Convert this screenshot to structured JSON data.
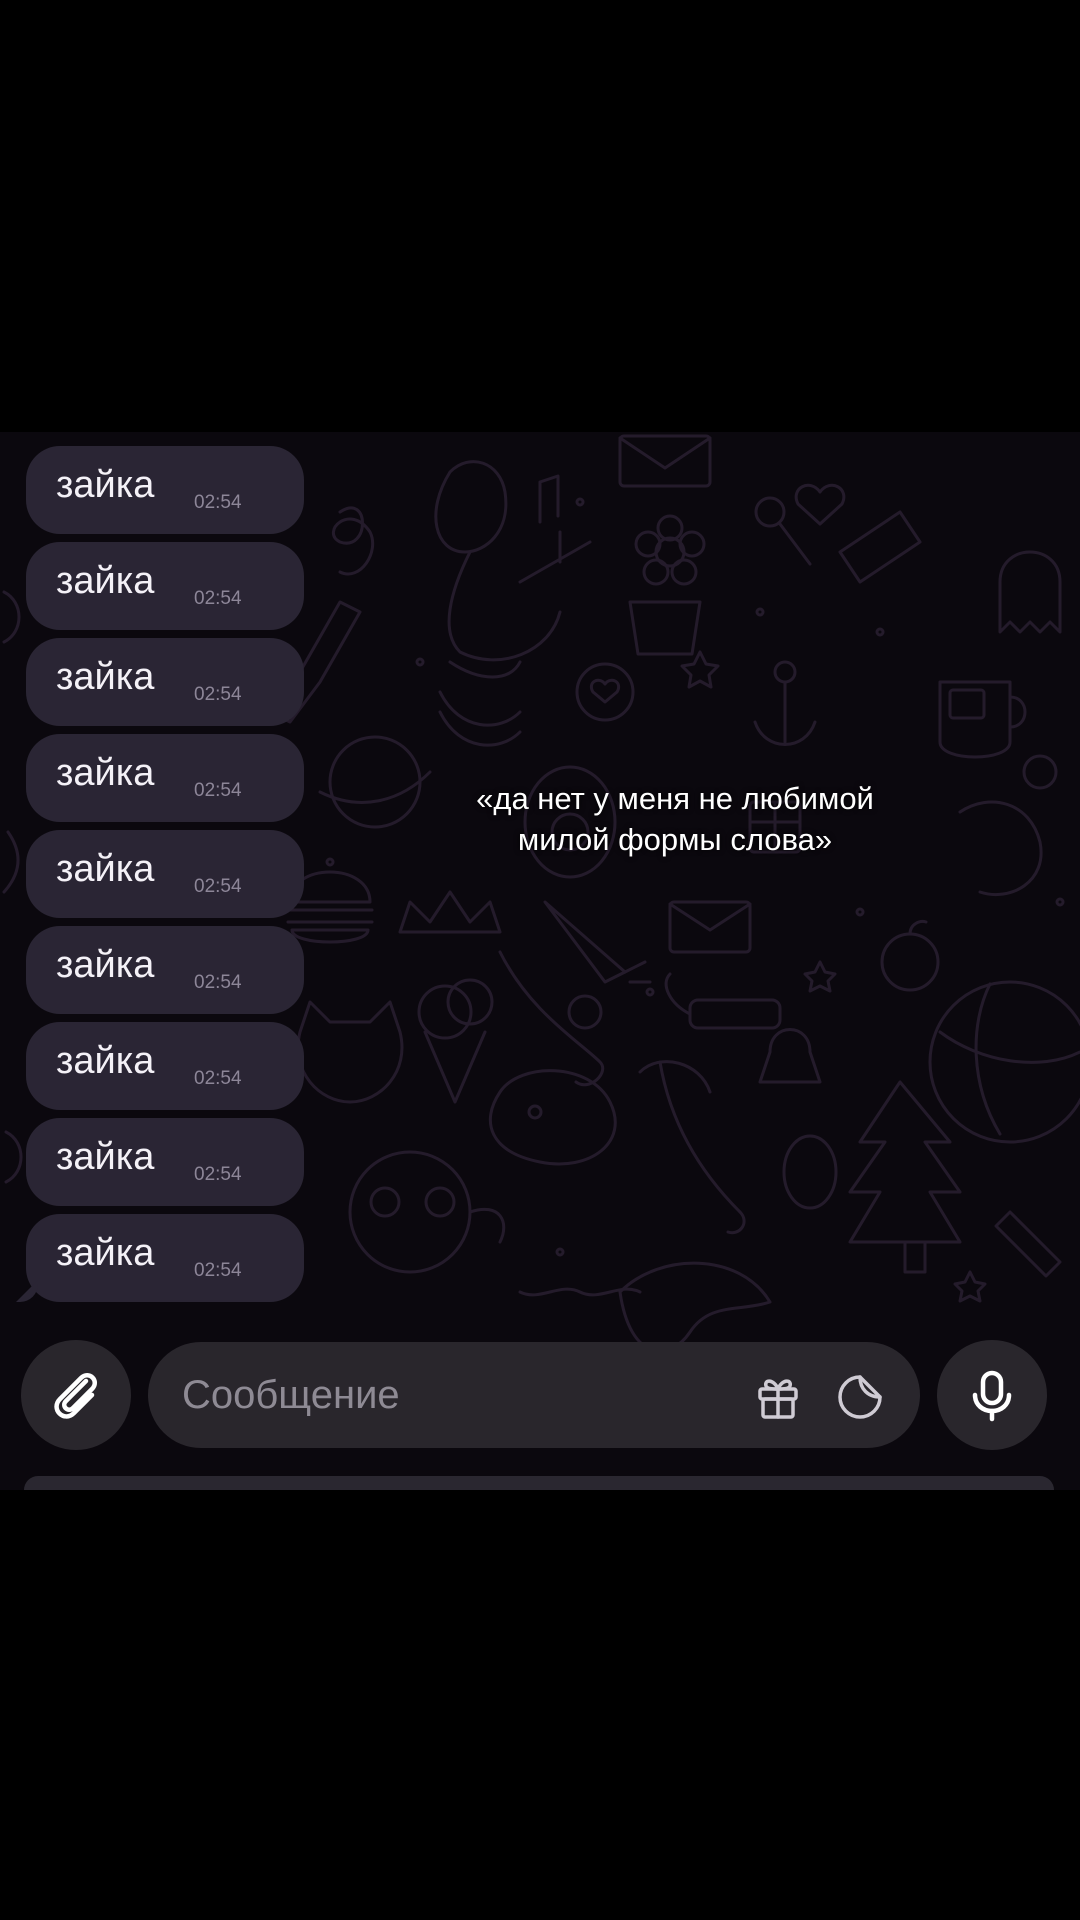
{
  "messages": [
    {
      "text": "зайка",
      "time": "02:54"
    },
    {
      "text": "зайка",
      "time": "02:54"
    },
    {
      "text": "зайка",
      "time": "02:54"
    },
    {
      "text": "зайка",
      "time": "02:54"
    },
    {
      "text": "зайка",
      "time": "02:54"
    },
    {
      "text": "зайка",
      "time": "02:54"
    },
    {
      "text": "зайка",
      "time": "02:54"
    },
    {
      "text": "зайка",
      "time": "02:54"
    },
    {
      "text": "зайка",
      "time": "02:54"
    }
  ],
  "caption": {
    "line1": "«да нет у меня не любимой",
    "line2": "милой формы слова»"
  },
  "composer": {
    "placeholder": "Сообщение",
    "attach_icon": "paperclip-icon",
    "gift_icon": "gift-icon",
    "sticker_icon": "sticker-icon",
    "mic_icon": "microphone-icon"
  },
  "colors": {
    "background": "#000000",
    "chat_background": "#0b080e",
    "bubble": "#2a2534",
    "composer": "#29262c",
    "text": "#f4f1f7",
    "time": "#8d8698"
  }
}
